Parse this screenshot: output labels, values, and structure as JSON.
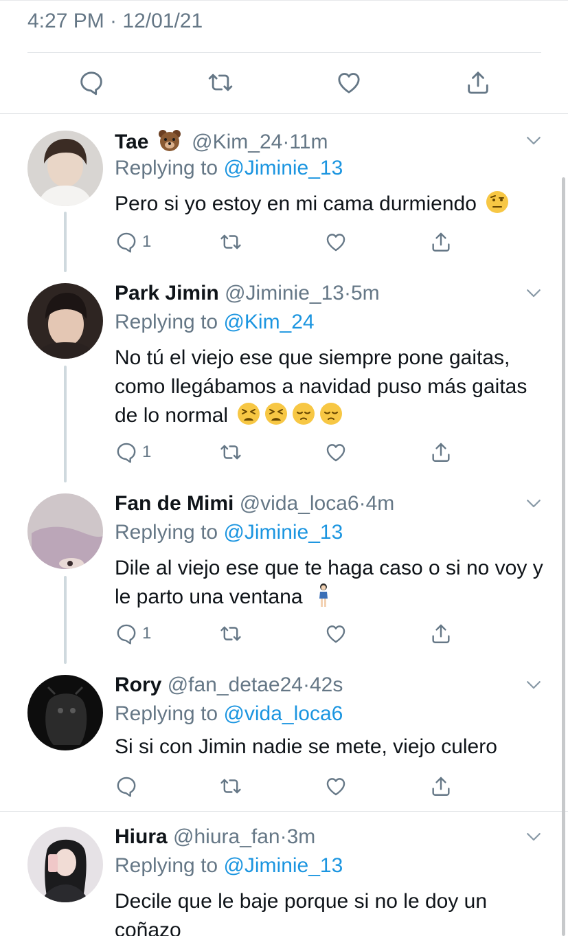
{
  "focused_tweet": {
    "timestamp": "4:27 PM · 12/01/21"
  },
  "replies": [
    {
      "name": "Tae",
      "name_emoji": "bear-emoji",
      "handle": "@Kim_24",
      "time": "11m",
      "replying_label": "Replying to",
      "replying_to": "@Jiminie_13",
      "text": "Pero si yo estoy en mi cama durmiendo",
      "text_emojis": [
        "raised-eyebrow-emoji"
      ],
      "reply_count": "1"
    },
    {
      "name": "Park Jimin",
      "handle": "@Jiminie_13",
      "time": "5m",
      "replying_label": "Replying to",
      "replying_to": "@Kim_24",
      "text": "No tú el viejo ese que siempre pone gaitas, como llegábamos a navidad puso más gaitas de lo normal",
      "text_emojis": [
        "tired-face-emoji",
        "tired-face-emoji",
        "pensive-face-emoji",
        "pensive-face-emoji"
      ],
      "reply_count": "1"
    },
    {
      "name": "Fan de Mimi",
      "handle": "@vida_loca6",
      "time": "4m",
      "replying_label": "Replying to",
      "replying_to": "@Jiminie_13",
      "text": "Dile al viejo ese que te haga caso o si no voy y le parto una ventana",
      "text_emojis": [
        "standing-woman-emoji"
      ],
      "reply_count": "1"
    },
    {
      "name": "Rory",
      "handle": "@fan_detae24",
      "time": "42s",
      "replying_label": "Replying to",
      "replying_to": "@vida_loca6",
      "text": "Si si con Jimin nadie se mete, viejo culero",
      "reply_count": ""
    },
    {
      "name": "Hiura",
      "handle": "@hiura_fan",
      "time": "3m",
      "replying_label": "Replying to",
      "replying_to": "@Jiminie_13",
      "text": "Decile que le baje porque si no le doy un coñazo"
    }
  ],
  "meta_separator": "·",
  "colors": {
    "accent": "#1b95e0",
    "secondary_text": "#657786",
    "primary_text": "#0f1419",
    "thread_line": "#cfd9de"
  }
}
